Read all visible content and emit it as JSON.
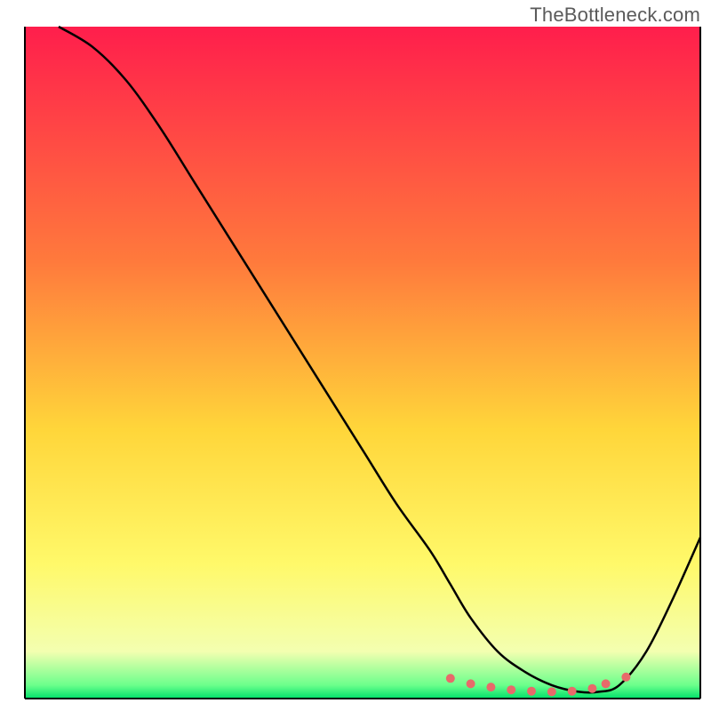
{
  "attribution": "TheBottleneck.com",
  "chart_data": {
    "type": "line",
    "title": "",
    "xlabel": "",
    "ylabel": "",
    "x_range": [
      0,
      100
    ],
    "y_range": [
      0,
      100
    ],
    "grid": false,
    "legend": false,
    "background_gradient": {
      "stops": [
        {
          "offset": 0.0,
          "color": "#ff1e4c"
        },
        {
          "offset": 0.35,
          "color": "#ff7a3c"
        },
        {
          "offset": 0.6,
          "color": "#ffd63a"
        },
        {
          "offset": 0.8,
          "color": "#fff96a"
        },
        {
          "offset": 0.93,
          "color": "#f3ffb0"
        },
        {
          "offset": 0.98,
          "color": "#6cff8c"
        },
        {
          "offset": 1.0,
          "color": "#00e06a"
        }
      ]
    },
    "series": [
      {
        "name": "bottleneck-curve",
        "color": "#000000",
        "x": [
          5,
          10,
          15,
          20,
          25,
          30,
          35,
          40,
          45,
          50,
          55,
          60,
          63,
          66,
          70,
          74,
          78,
          82,
          85,
          88,
          92,
          96,
          100
        ],
        "y": [
          100,
          97,
          92,
          85,
          77,
          69,
          61,
          53,
          45,
          37,
          29,
          22,
          17,
          12,
          7,
          4,
          2,
          1,
          1,
          2,
          7,
          15,
          24
        ]
      }
    ],
    "markers": {
      "name": "highlight-dots",
      "color": "#e86a6a",
      "radius": 5,
      "x": [
        63,
        66,
        69,
        72,
        75,
        78,
        81,
        84,
        86,
        89
      ],
      "y": [
        3,
        2.2,
        1.7,
        1.3,
        1.1,
        1.0,
        1.1,
        1.5,
        2.2,
        3.2
      ]
    }
  }
}
